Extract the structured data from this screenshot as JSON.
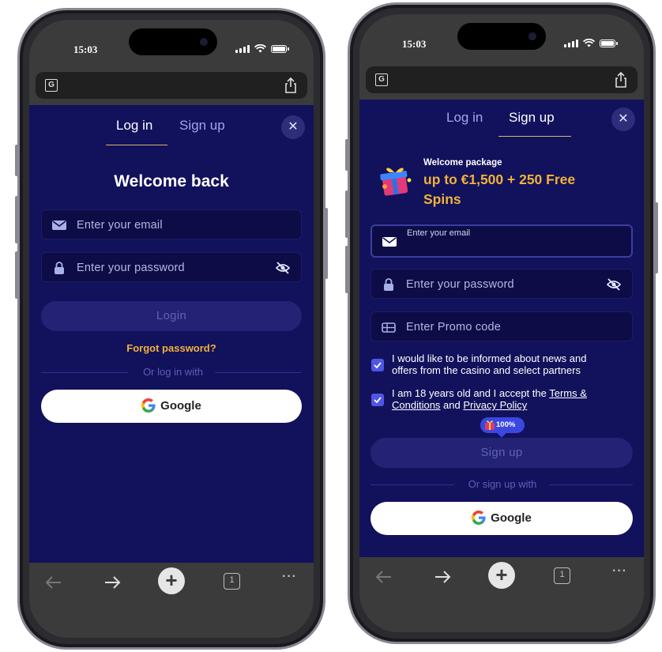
{
  "status": {
    "time": "15:03"
  },
  "toolbar": {
    "tab_count": "1"
  },
  "login_screen": {
    "tabs": {
      "login": "Log in",
      "signup": "Sign up"
    },
    "title": "Welcome back",
    "email_placeholder": "Enter your email",
    "password_placeholder": "Enter your password",
    "login_button": "Login",
    "forgot_link": "Forgot password?",
    "divider": "Or log in with",
    "google_button": "Google"
  },
  "signup_screen": {
    "tabs": {
      "login": "Log in",
      "signup": "Sign up"
    },
    "promo_label": "Welcome package",
    "promo_offer_line1": "up to €1,500 + 250 Free",
    "promo_offer_line2": "Spins",
    "email_label": "Enter your email",
    "password_placeholder": "Enter your password",
    "promo_placeholder": "Enter Promo code",
    "consent_news": {
      "line1": "I would like to be informed about news and",
      "line2": "offers from the casino and select partners",
      "checked": true
    },
    "consent_age": {
      "prefix": "I am 18 years old and I accept the ",
      "terms_link_1": "Terms &",
      "terms_link_2": "Conditions",
      "and": " and ",
      "privacy_link": "Privacy Policy",
      "checked": true
    },
    "bonus_badge": "100%",
    "signup_button": "Sign up",
    "divider": "Or sign up with",
    "google_button": "Google"
  },
  "colors": {
    "page_bg": "#12115c",
    "accent_gold": "#f0b23a",
    "checkbox": "#4f56e6",
    "badge": "#3a48e0"
  }
}
